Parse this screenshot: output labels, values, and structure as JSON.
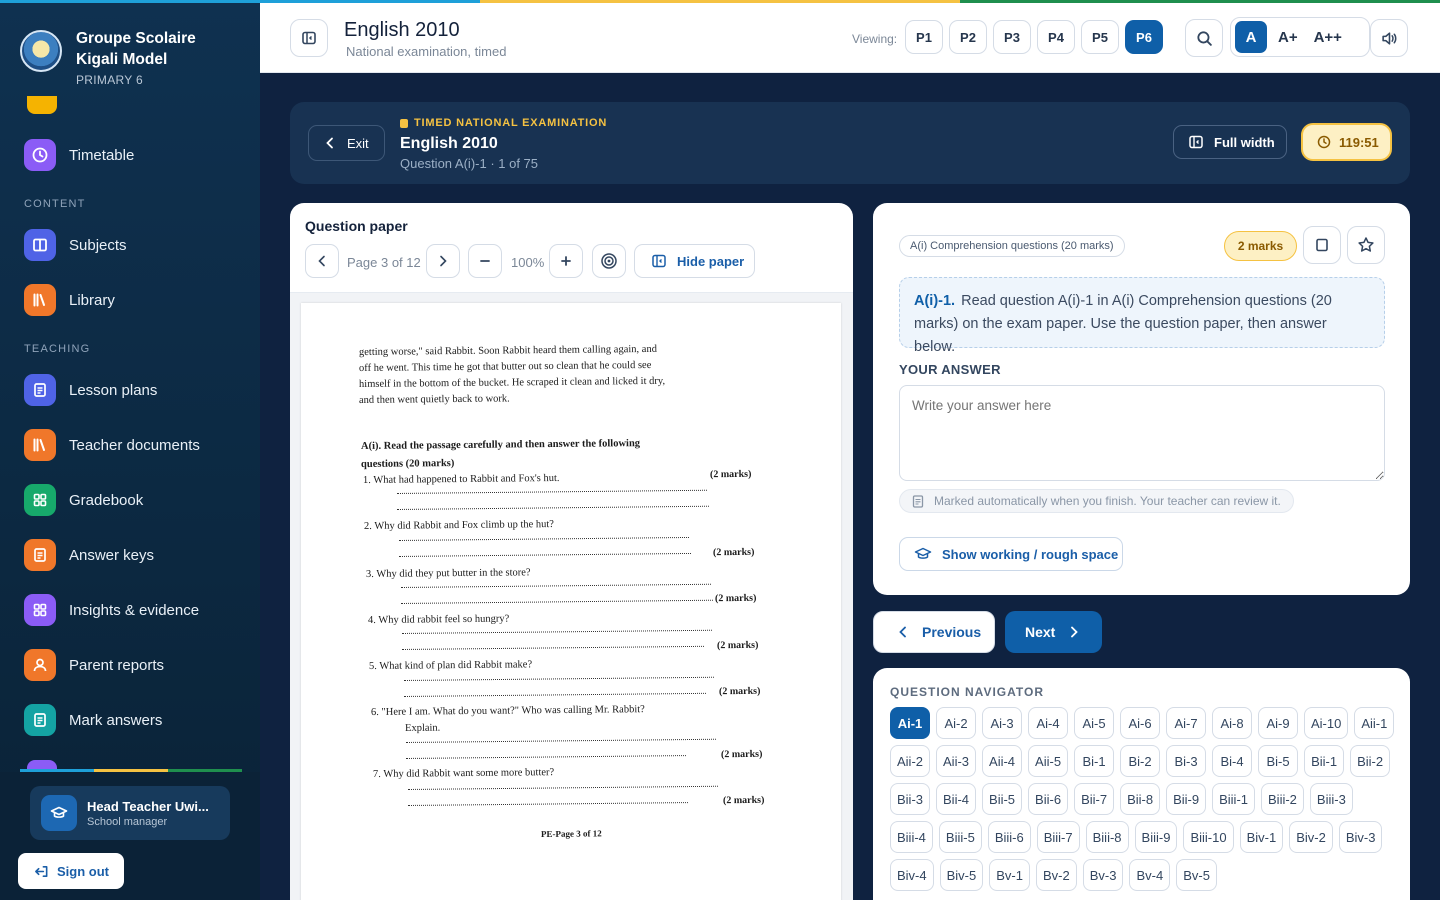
{
  "colors": {
    "accent": "#0f5fa8",
    "warning": "#f5c242",
    "stripe": [
      "#1ea0d9",
      "#f5c242",
      "#1f8f4e"
    ]
  },
  "sidebar": {
    "school_name_line1": "Groupe Scolaire",
    "school_name_line2": "Kigali Model",
    "class": "PRIMARY 6",
    "items": [
      {
        "label": "Timetable",
        "icon": "clock-icon",
        "color": "#8b5cf6"
      },
      {
        "label": "Subjects",
        "icon": "book-icon",
        "color": "#4f63e6"
      },
      {
        "label": "Library",
        "icon": "books-icon",
        "color": "#f0772a"
      },
      {
        "label": "Lesson plans",
        "icon": "document-icon",
        "color": "#4f63e6"
      },
      {
        "label": "Teacher documents",
        "icon": "books-icon",
        "color": "#f0772a"
      },
      {
        "label": "Gradebook",
        "icon": "grid-icon",
        "color": "#17a96b"
      },
      {
        "label": "Answer keys",
        "icon": "document-icon",
        "color": "#f0772a"
      },
      {
        "label": "Insights & evidence",
        "icon": "grid-icon",
        "color": "#8b5cf6"
      },
      {
        "label": "Parent reports",
        "icon": "user-icon",
        "color": "#f0772a"
      },
      {
        "label": "Mark answers",
        "icon": "document-icon",
        "color": "#14a3a3"
      }
    ],
    "sections": {
      "content": "CONTENT",
      "teaching": "TEACHING"
    },
    "user": {
      "name": "Head Teacher Uwi...",
      "role": "School manager"
    },
    "sign_out": "Sign out"
  },
  "header": {
    "title": "English 2010",
    "subtitle": "National examination, timed",
    "viewing_label": "Viewing:",
    "levels": [
      "P1",
      "P2",
      "P3",
      "P4",
      "P5",
      "P6"
    ],
    "active_level": "P6",
    "font_sizes": [
      "A",
      "A+",
      "A++"
    ]
  },
  "exam": {
    "exit": "Exit",
    "kicker": "TIMED NATIONAL EXAMINATION",
    "title": "English 2010",
    "question_pos": "Question A(i)-1 · 1 of 75",
    "full_width": "Full width",
    "timer": "119:51"
  },
  "paper": {
    "label": "Question paper",
    "page": "Page 3 of 12",
    "zoom": "100%",
    "hide": "Hide paper",
    "scan": {
      "intro": [
        "getting worse,\" said Rabbit. Soon Rabbit heard them calling again, and",
        "off he went. This time he got that butter out so clean that he could see",
        "himself in the bottom of the bucket. He scraped it clean and licked it dry,",
        "and then went quietly back to work."
      ],
      "instruction1": "A(i). Read the passage carefully and then answer the following",
      "instruction2": "questions      (20 marks)",
      "questions": [
        "1. What had happened to Rabbit and Fox's hut.",
        "2. Why did  Rabbit and Fox climb up the hut?",
        "3. Why did they put butter in the store?",
        "4. Why did rabbit feel so hungry?",
        "5. What kind of plan did Rabbit make?",
        "6. \"Here I am. What do you want?\" Who was calling Mr. Rabbit?",
        "7. Why did Rabbit want some more butter?"
      ],
      "q6_extra": "Explain.",
      "marks": "(2 marks)",
      "footer": "PE-Page 3 of 12"
    }
  },
  "question": {
    "section": "A(i) Comprehension questions (20 marks)",
    "marks": "2 marks",
    "number": "A(i)-1.",
    "text": "Read question A(i)-1 in A(i) Comprehension questions (20 marks) on the exam paper. Use the question paper, then answer below.",
    "your_answer": "YOUR ANSWER",
    "placeholder": "Write your answer here",
    "auto_note": "Marked automatically when you finish. Your teacher can review it.",
    "show_working": "Show working / rough space"
  },
  "nav": {
    "previous": "Previous",
    "next": "Next"
  },
  "navigator": {
    "title": "QUESTION NAVIGATOR",
    "current": "Ai-1",
    "items": [
      "Ai-1",
      "Ai-2",
      "Ai-3",
      "Ai-4",
      "Ai-5",
      "Ai-6",
      "Ai-7",
      "Ai-8",
      "Ai-9",
      "Ai-10",
      "Aii-1",
      "Aii-2",
      "Aii-3",
      "Aii-4",
      "Aii-5",
      "Bi-1",
      "Bi-2",
      "Bi-3",
      "Bi-4",
      "Bi-5",
      "Bii-1",
      "Bii-2",
      "Bii-3",
      "Bii-4",
      "Bii-5",
      "Bii-6",
      "Bii-7",
      "Bii-8",
      "Bii-9",
      "Biii-1",
      "Biii-2",
      "Biii-3",
      "Biii-4",
      "Biii-5",
      "Biii-6",
      "Biii-7",
      "Biii-8",
      "Biii-9",
      "Biii-10",
      "Biv-1",
      "Biv-2",
      "Biv-3",
      "Biv-4",
      "Biv-5",
      "Bv-1",
      "Bv-2",
      "Bv-3",
      "Bv-4",
      "Bv-5"
    ]
  }
}
